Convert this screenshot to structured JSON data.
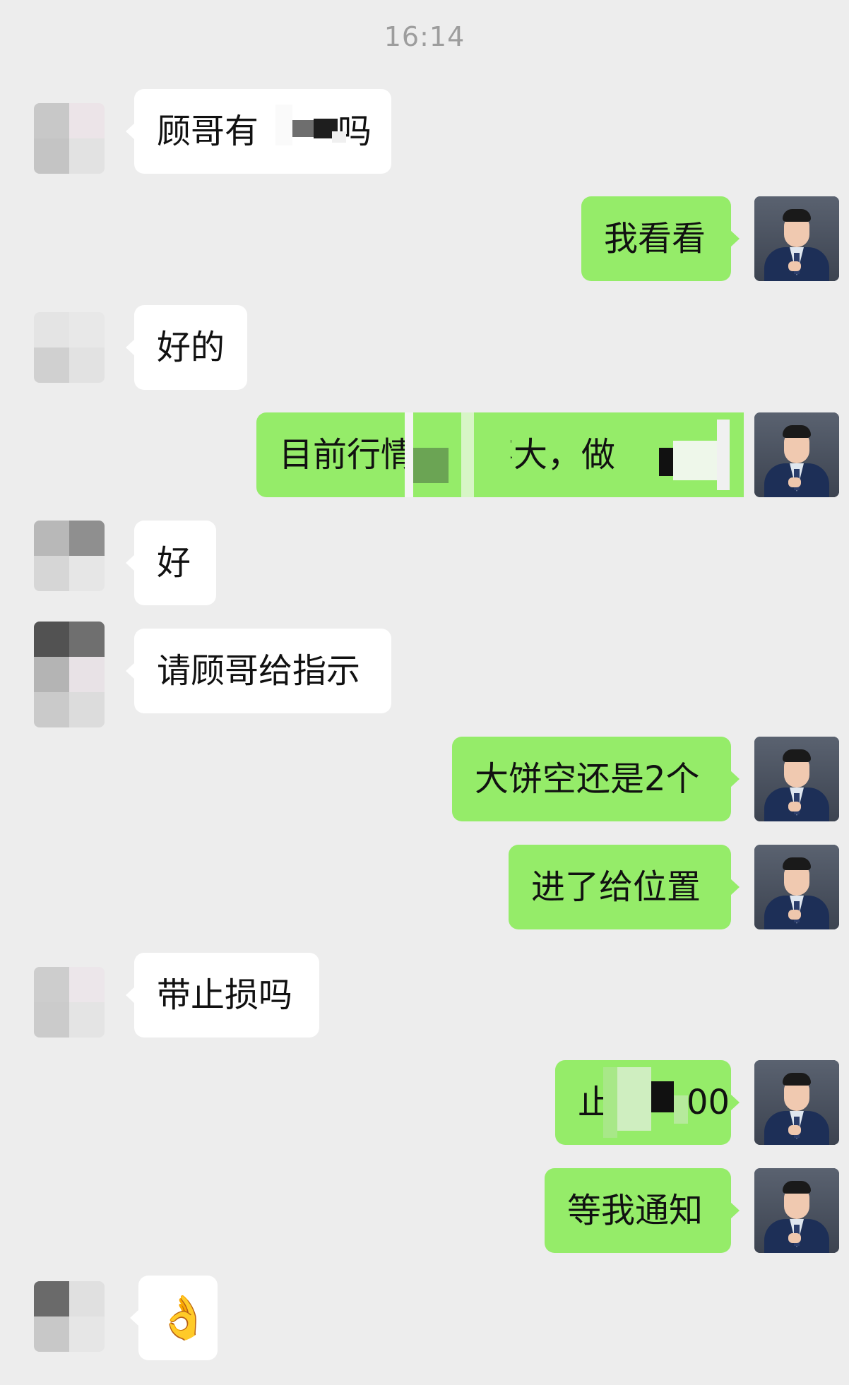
{
  "timestamp": "16:14",
  "messages": [
    {
      "side": "left",
      "text": "顾哥有",
      "text_tail": "吗",
      "redacted": true
    },
    {
      "side": "right",
      "text": "我看看"
    },
    {
      "side": "left",
      "text": "好的"
    },
    {
      "side": "right",
      "text": "目前行情",
      "text_mid": "不大，做",
      "redacted": true
    },
    {
      "side": "left",
      "text": "好"
    },
    {
      "side": "left",
      "text": "请顾哥给指示"
    },
    {
      "side": "right",
      "text": "大饼空还是2个"
    },
    {
      "side": "right",
      "text": "进了给位置"
    },
    {
      "side": "left",
      "text": "带止损吗"
    },
    {
      "side": "right",
      "text": "止",
      "text_tail": "00",
      "redacted": true
    },
    {
      "side": "right",
      "text": "等我通知"
    },
    {
      "side": "left",
      "emoji": "👌"
    }
  ],
  "colors": {
    "background": "#ededed",
    "bubble_left": "#ffffff",
    "bubble_right": "#95ec69",
    "timestamp": "#9d9d9d"
  },
  "icons": {
    "contact_avatar": "blurred-mosaic-avatar",
    "self_avatar": "man-in-suit-avatar"
  }
}
